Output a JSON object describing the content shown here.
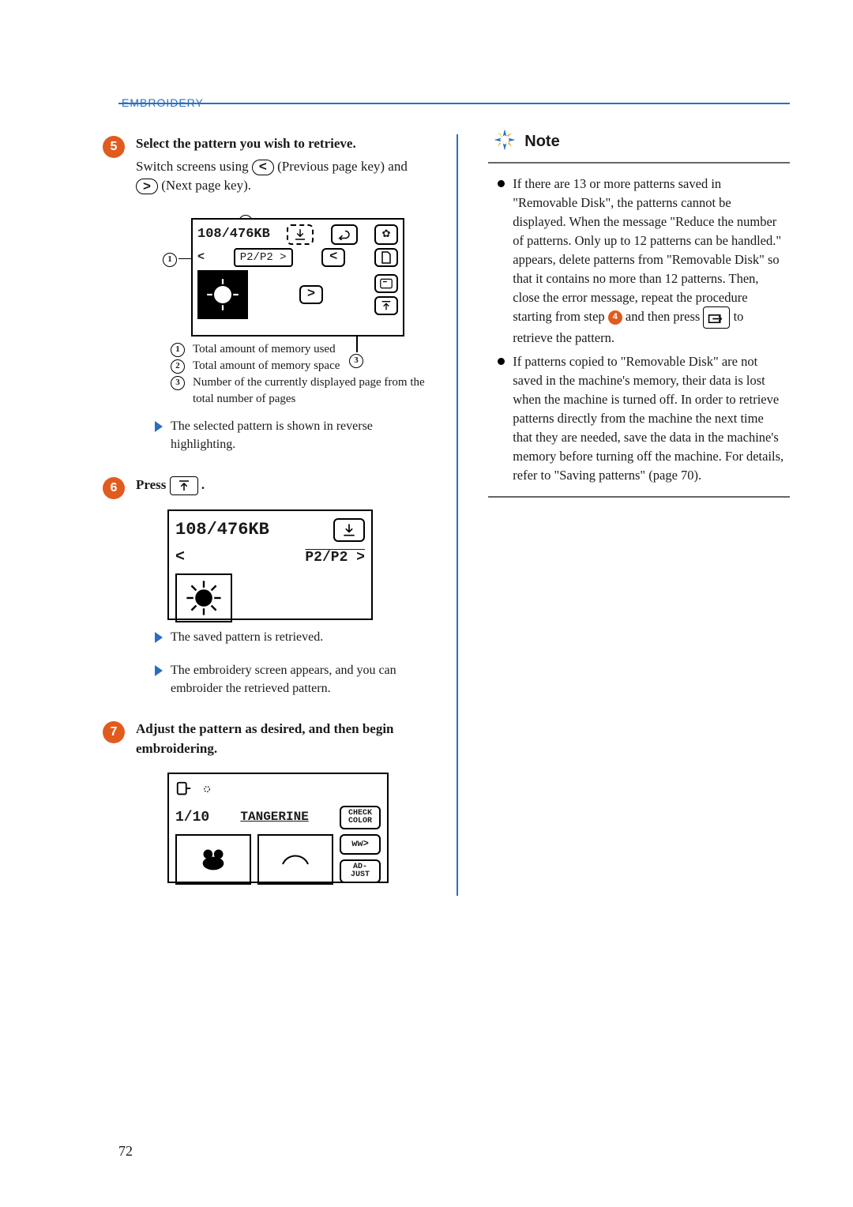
{
  "header": {
    "section": "EMBROIDERY"
  },
  "steps": {
    "s5": {
      "num": "5",
      "title": "Select the pattern you wish to retrieve.",
      "body_a": "Switch screens using ",
      "prev_key_label": "<",
      "body_b": " (Previous page key) and ",
      "next_key_label": ">",
      "body_c": " (Next page key).",
      "screen": {
        "memory": "108/476KB",
        "pager": "P2/P2 >"
      },
      "legend": {
        "l1": "Total amount of memory used",
        "l2": "Total amount of memory space",
        "l3": "Number of the currently displayed page from the total number of pages"
      },
      "result": "The selected pattern is shown in reverse highlighting."
    },
    "s6": {
      "num": "6",
      "title_pre": "Press ",
      "title_post": ".",
      "screen": {
        "memory": "108/476KB",
        "pager": "P2/P2 >"
      },
      "result_a": "The saved pattern is retrieved.",
      "result_b": "The embroidery screen appears, and you can embroider the retrieved pattern."
    },
    "s7": {
      "num": "7",
      "title": "Adjust the pattern as desired, and then begin embroidering.",
      "screen": {
        "count": "1/10",
        "color": "TANGERINE",
        "btn_check": "CHECK\nCOLOR",
        "btn_adjust": "AD-\nJUST"
      }
    }
  },
  "note": {
    "heading": "Note",
    "items": [
      {
        "pre": "If there are 13 or more patterns saved in \"Removable Disk\", the patterns cannot be displayed. When the message \"Reduce the number of patterns. Only up to 12 patterns can be handled.\" appears, delete patterns from \"Removable Disk\" so that it contains no more than 12 patterns. Then, close the error message, repeat the procedure starting from step ",
        "step_ref": "4",
        "mid": " and then press ",
        "post": " to retrieve the pattern."
      },
      {
        "text": "If patterns copied to \"Removable Disk\" are not saved in the machine's memory, their data is lost when the machine is turned off. In order to retrieve patterns directly from the machine the next time that they are needed, save the data in the machine's memory before turning off the machine. For details, refer to \"Saving patterns\" (page 70)."
      }
    ]
  },
  "page_number": "72"
}
